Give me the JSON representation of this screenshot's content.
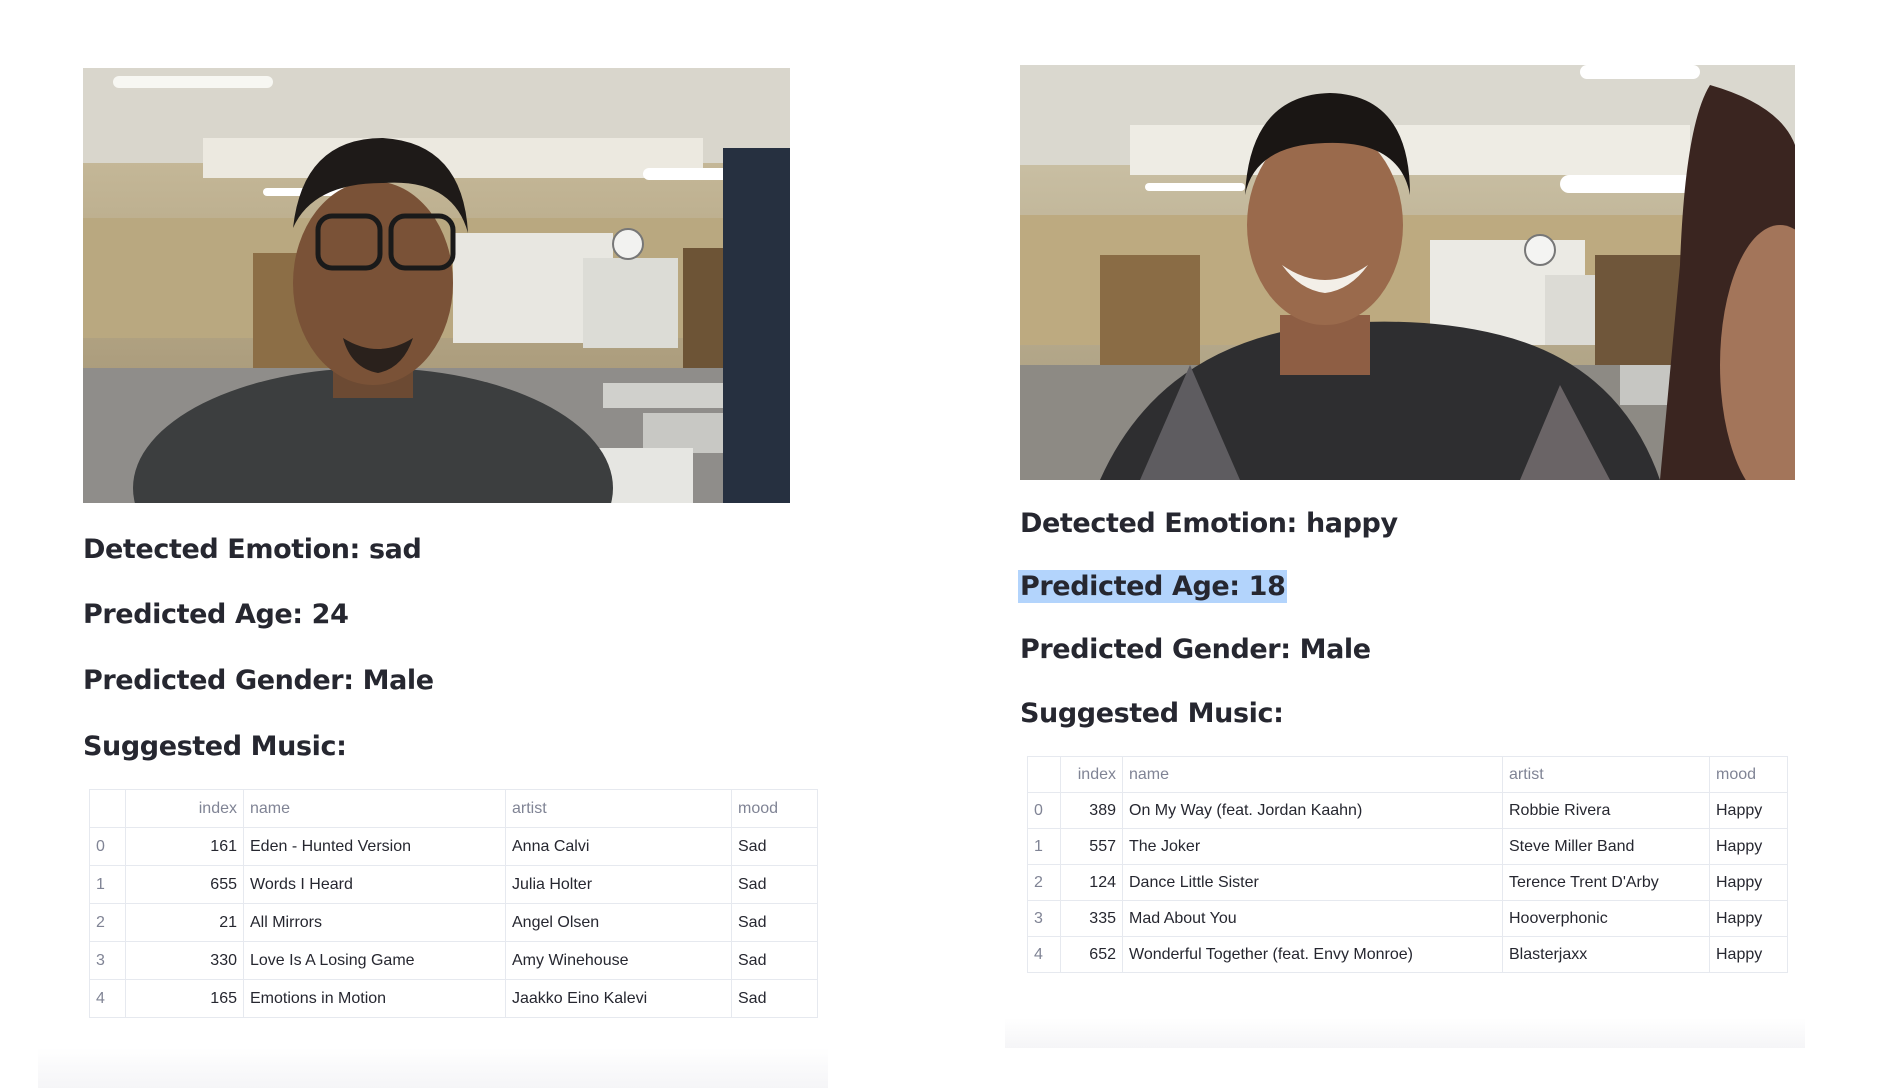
{
  "left": {
    "emotion": "Detected Emotion: sad",
    "age": "Predicted Age: 24",
    "gender": "Predicted Gender: Male",
    "music_heading": "Suggested Music:",
    "table": {
      "columns": [
        "",
        "index",
        "name",
        "artist",
        "mood"
      ],
      "rows": [
        [
          "0",
          "161",
          "Eden - Hunted Version",
          "Anna Calvi",
          "Sad"
        ],
        [
          "1",
          "655",
          "Words I Heard",
          "Julia Holter",
          "Sad"
        ],
        [
          "2",
          "21",
          "All Mirrors",
          "Angel Olsen",
          "Sad"
        ],
        [
          "3",
          "330",
          "Love Is A Losing Game",
          "Amy Winehouse",
          "Sad"
        ],
        [
          "4",
          "165",
          "Emotions in Motion",
          "Jaakko Eino Kalevi",
          "Sad"
        ]
      ]
    }
  },
  "right": {
    "emotion": "Detected Emotion: happy",
    "age": "Predicted Age: 18",
    "gender": "Predicted Gender: Male",
    "music_heading": "Suggested Music:",
    "table": {
      "columns": [
        "",
        "index",
        "name",
        "artist",
        "mood"
      ],
      "rows": [
        [
          "0",
          "389",
          "On My Way (feat. Jordan Kaahn)",
          "Robbie Rivera",
          "Happy"
        ],
        [
          "1",
          "557",
          "The Joker",
          "Steve Miller Band",
          "Happy"
        ],
        [
          "2",
          "124",
          "Dance Little Sister",
          "Terence Trent D'Arby",
          "Happy"
        ],
        [
          "3",
          "335",
          "Mad About You",
          "Hooverphonic",
          "Happy"
        ],
        [
          "4",
          "652",
          "Wonderful Together (feat. Envy Monroe)",
          "Blasterjaxx",
          "Happy"
        ]
      ]
    }
  }
}
